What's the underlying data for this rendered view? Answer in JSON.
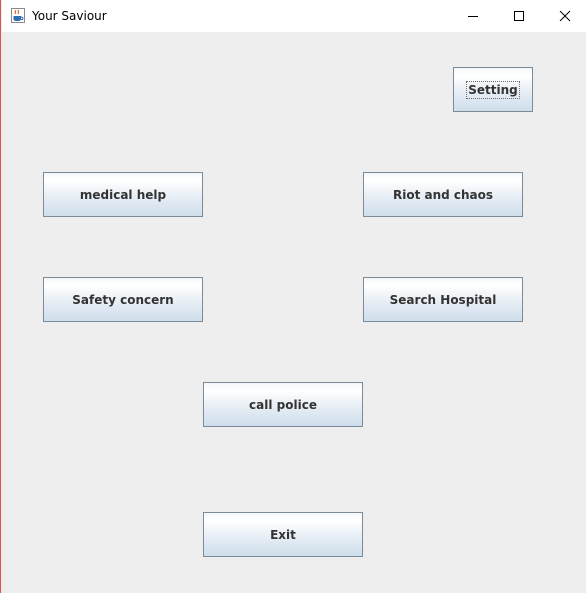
{
  "window": {
    "title": "Your Saviour",
    "app_icon": "java-cup-icon",
    "controls": {
      "minimize_icon": "minimize-icon",
      "maximize_icon": "maximize-icon",
      "close_icon": "close-icon"
    }
  },
  "buttons": {
    "setting": "Setting",
    "medical_help": "medical help",
    "riot_and_chaos": "Riot and chaos",
    "safety_concern": "Safety concern",
    "search_hospital": "Search Hospital",
    "call_police": "call police",
    "exit": "Exit"
  },
  "colors": {
    "window_background": "#eeeeee",
    "titlebar_background": "#ffffff",
    "button_border": "#7a8a99",
    "button_gradient_bottom": "#cfdeec",
    "button_text": "#333333",
    "window_edge": "#d9534f"
  }
}
